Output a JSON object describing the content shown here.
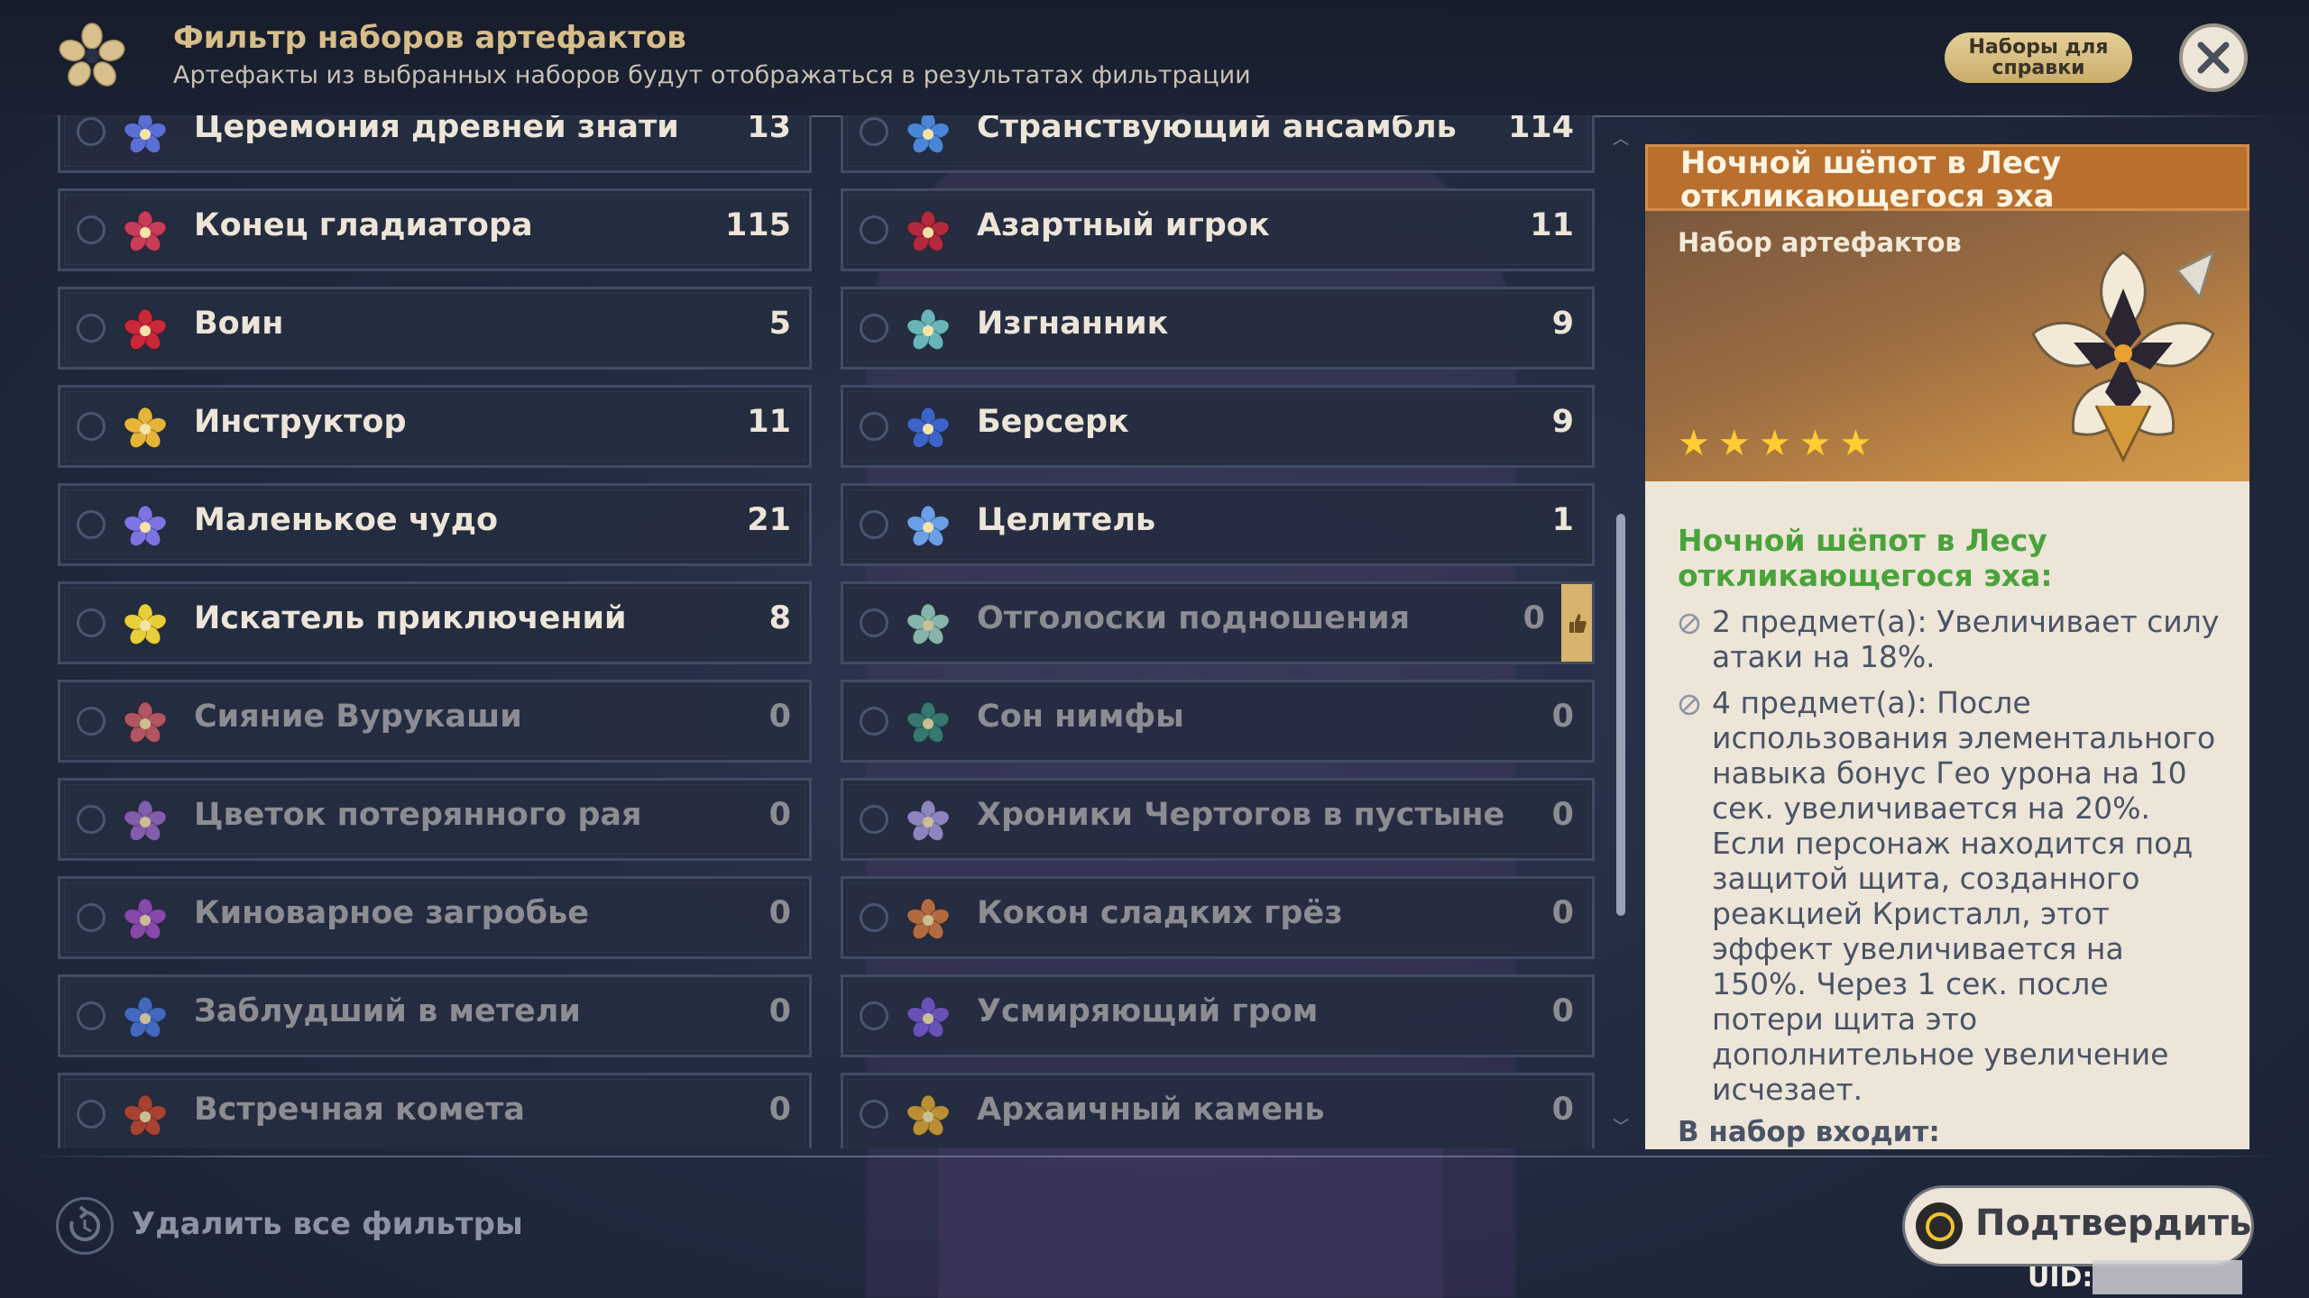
{
  "header": {
    "title": "Фильтр наборов артефактов",
    "subtitle": "Артефакты из выбранных наборов будут отображаться в результатах фильтрации",
    "reference_button": "Наборы для справки",
    "close_icon": "close-icon"
  },
  "sets": [
    {
      "name": "Церемония древней знати",
      "count": "13",
      "active": true,
      "icon_color": "#5a6fd6"
    },
    {
      "name": "Странствующий ансамбль",
      "count": "114",
      "active": true,
      "icon_color": "#4a86d8"
    },
    {
      "name": "Конец гладиатора",
      "count": "115",
      "active": true,
      "icon_color": "#c73c58"
    },
    {
      "name": "Азартный игрок",
      "count": "11",
      "active": true,
      "icon_color": "#b2283c"
    },
    {
      "name": "Воин",
      "count": "5",
      "active": true,
      "icon_color": "#c8283a"
    },
    {
      "name": "Изгнанник",
      "count": "9",
      "active": true,
      "icon_color": "#67b5b8"
    },
    {
      "name": "Инструктор",
      "count": "11",
      "active": true,
      "icon_color": "#e6b43a"
    },
    {
      "name": "Берсерк",
      "count": "9",
      "active": true,
      "icon_color": "#3c63c8"
    },
    {
      "name": "Маленькое чудо",
      "count": "21",
      "active": true,
      "icon_color": "#7c74e0"
    },
    {
      "name": "Целитель",
      "count": "1",
      "active": true,
      "icon_color": "#6a9ee6"
    },
    {
      "name": "Искатель приключений",
      "count": "8",
      "active": true,
      "icon_color": "#e8cf3a"
    },
    {
      "name": "Отголоски подношения",
      "count": "0",
      "active": false,
      "icon_color": "#9ed6c4",
      "thumb": true
    },
    {
      "name": "Сияние Вурукаши",
      "count": "0",
      "active": false,
      "icon_color": "#d4606a"
    },
    {
      "name": "Сон нимфы",
      "count": "0",
      "active": false,
      "icon_color": "#3a8a7a"
    },
    {
      "name": "Цветок потерянного рая",
      "count": "0",
      "active": false,
      "icon_color": "#9a6ac8"
    },
    {
      "name": "Хроники Чертогов в пустыне",
      "count": "0",
      "active": false,
      "icon_color": "#a89ae0"
    },
    {
      "name": "Киноварное загробье",
      "count": "0",
      "active": false,
      "icon_color": "#a050c8"
    },
    {
      "name": "Кокон сладких грёз",
      "count": "0",
      "active": false,
      "icon_color": "#d87a40"
    },
    {
      "name": "Заблудший в метели",
      "count": "0",
      "active": false,
      "icon_color": "#4a78e0"
    },
    {
      "name": "Усмиряющий гром",
      "count": "0",
      "active": false,
      "icon_color": "#7a5ad8"
    },
    {
      "name": "Встречная комета",
      "count": "0",
      "active": false,
      "icon_color": "#c84830"
    },
    {
      "name": "Архаичный камень",
      "count": "0",
      "active": false,
      "icon_color": "#e0a830"
    }
  ],
  "detail": {
    "title": "Ночной шёпот в Лесу откликающегося эха",
    "type": "Набор артефактов",
    "rarity": 5,
    "desc_title": "Ночной шёпот в Лесу откликающегося эха:",
    "bonuses": [
      "2 предмет(а): Увеличивает силу атаки на 18%.",
      "4 предмет(а): После использования элементального навыка бонус Гео урона на 10 сек. увеличивается на 20%. Если персонаж находится под защитой щита, созданного реакцией Кристалл, этот эффект увеличивается на 150%. Через 1 сек. после потери щита это дополнительное увеличение исчезает."
    ],
    "includes_label": "В набор входит:"
  },
  "footer": {
    "reset_label": "Удалить все фильтры",
    "confirm_label": "Подтвердить",
    "uid_label": "UID:"
  },
  "colors": {
    "accent_gold": "#d6bd8a",
    "bonus_title_green": "#4aa33a",
    "card_header": "#b9702f"
  }
}
